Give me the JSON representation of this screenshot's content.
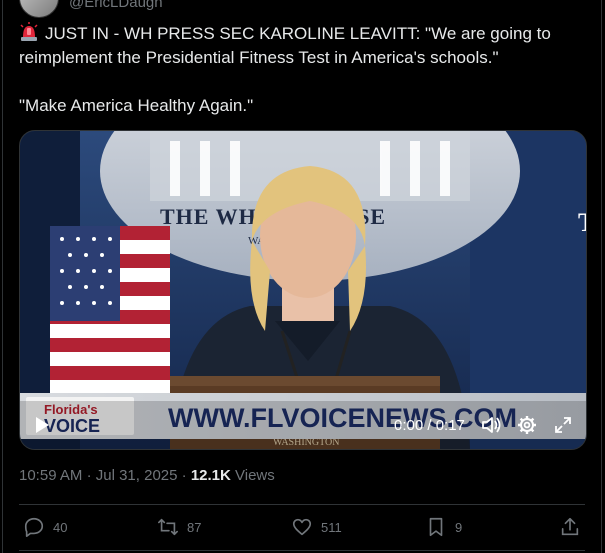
{
  "header": {
    "handle": "@EricLDaugh"
  },
  "tweet": {
    "siren_icon": "police-light-emoji",
    "line1": "JUST IN - WH PRESS SEC KAROLINE LEAVITT: \"We are going to reimplement the Presidential Fitness Test in America's schools.\"",
    "line2": "\"Make America Healthy Again.\""
  },
  "video": {
    "backdrop_text": "THE WHITE HOUSE",
    "backdrop_sub": "WASHINGTON",
    "podium_text": "WASHINGTON",
    "banner_logo_top": "Florida's",
    "banner_logo_bottom": "VOICE",
    "banner_url": "WWW.FLVOICENEWS.COM",
    "time_display": "0:00 / 0:17",
    "play_icon": "play-icon",
    "volume_icon": "volume-icon",
    "settings_icon": "gear-icon",
    "fullscreen_icon": "fullscreen-icon"
  },
  "meta": {
    "time": "10:59 AM",
    "sep1": "·",
    "date": "Jul 31, 2025",
    "sep2": "·",
    "views_count": "12.1K",
    "views_label": "Views"
  },
  "actions": {
    "replies": "40",
    "retweets": "87",
    "likes": "511",
    "bookmarks": "9"
  },
  "colors": {
    "background": "#000000",
    "text": "#e7e9ea",
    "muted": "#71767b",
    "border": "#2f3336"
  }
}
